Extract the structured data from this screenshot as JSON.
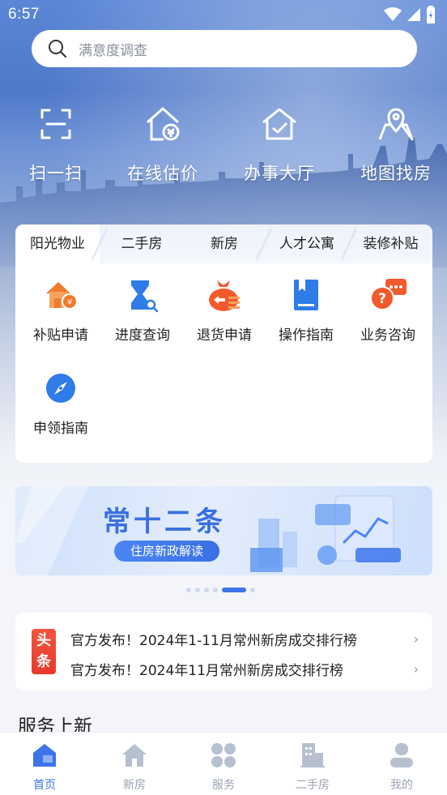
{
  "status_bar": {
    "time": "6:57"
  },
  "search": {
    "placeholder": "满意度调查"
  },
  "top_nav": [
    {
      "label": "扫一扫",
      "icon": "scan-icon"
    },
    {
      "label": "在线估价",
      "icon": "house-price-icon"
    },
    {
      "label": "办事大厅",
      "icon": "service-hall-icon"
    },
    {
      "label": "地图找房",
      "icon": "map-icon"
    }
  ],
  "service_tabs": [
    "阳光物业",
    "二手房",
    "新房",
    "人才公寓",
    "装修补贴"
  ],
  "services": [
    {
      "label": "补贴申请",
      "icon": "subsidy-icon"
    },
    {
      "label": "进度查询",
      "icon": "progress-query-icon"
    },
    {
      "label": "退货申请",
      "icon": "return-icon"
    },
    {
      "label": "操作指南",
      "icon": "guide-book-icon"
    },
    {
      "label": "业务咨询",
      "icon": "consult-icon"
    },
    {
      "label": "申领指南",
      "icon": "compass-icon"
    }
  ],
  "banner": {
    "title": "常十二条",
    "subtitle": "住房新政解读"
  },
  "carousel": {
    "count": 6,
    "active": 4
  },
  "headlines": {
    "badge": "头条",
    "items": [
      "官方发布！2024年1-11月常州新房成交排行榜",
      "官方发布！2024年11月常州新房成交排行榜"
    ]
  },
  "section": {
    "title": "服务上新"
  },
  "bottom_tabs": [
    {
      "label": "首页",
      "active": true
    },
    {
      "label": "新房",
      "active": false
    },
    {
      "label": "服务",
      "active": false
    },
    {
      "label": "二手房",
      "active": false
    },
    {
      "label": "我的",
      "active": false
    }
  ],
  "colors": {
    "accent": "#3d74ec",
    "orange": "#f27a2c",
    "red": "#e8392a"
  }
}
